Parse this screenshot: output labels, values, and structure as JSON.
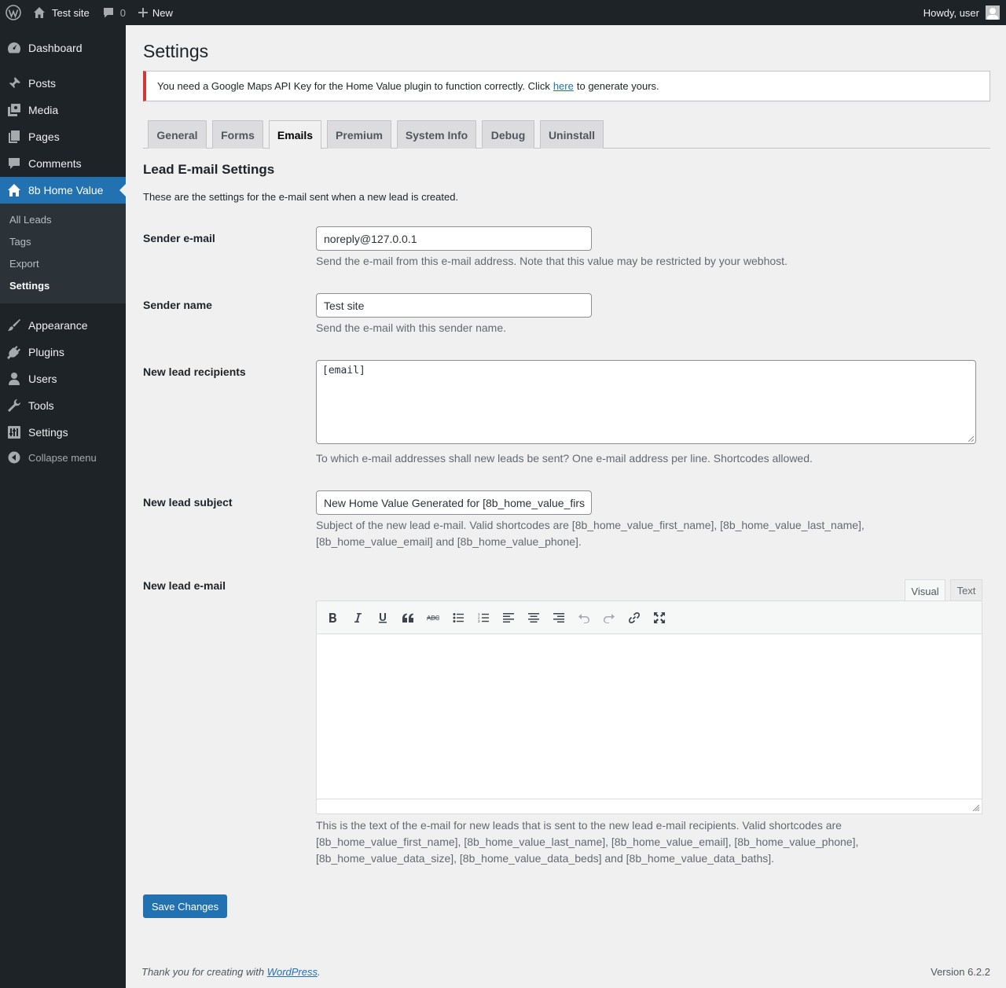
{
  "adminbar": {
    "site_name": "Test site",
    "comments_count": "0",
    "new_label": "New",
    "howdy": "Howdy, user"
  },
  "menu": {
    "items": [
      {
        "label": "Dashboard",
        "icon": "dashboard-icon"
      },
      {
        "label": "Posts",
        "icon": "pin-icon"
      },
      {
        "label": "Media",
        "icon": "media-icon"
      },
      {
        "label": "Pages",
        "icon": "pages-icon"
      },
      {
        "label": "Comments",
        "icon": "comment-icon"
      },
      {
        "label": "8b Home Value",
        "icon": "home-icon"
      },
      {
        "label": "Appearance",
        "icon": "brush-icon"
      },
      {
        "label": "Plugins",
        "icon": "plug-icon"
      },
      {
        "label": "Users",
        "icon": "user-icon"
      },
      {
        "label": "Tools",
        "icon": "wrench-icon"
      },
      {
        "label": "Settings",
        "icon": "settings-icon"
      }
    ],
    "submenu": [
      "All Leads",
      "Tags",
      "Export",
      "Settings"
    ],
    "collapse_label": "Collapse menu"
  },
  "page": {
    "title": "Settings",
    "notice": {
      "text_before": "You need a Google Maps API Key for the Home Value plugin to function correctly. Click",
      "link": "here",
      "text_after": "to generate yours."
    },
    "tabs": [
      "General",
      "Forms",
      "Emails",
      "Premium",
      "System Info",
      "Debug",
      "Uninstall"
    ],
    "active_tab": "Emails",
    "section_title": "Lead E-mail Settings",
    "section_desc": "These are the settings for the e-mail sent when a new lead is created."
  },
  "fields": {
    "sender_email": {
      "label": "Sender e-mail",
      "value": "noreply@127.0.0.1",
      "desc": "Send the e-mail from this e-mail address. Note that this value may be restricted by your webhost."
    },
    "sender_name": {
      "label": "Sender name",
      "value": "Test site",
      "desc": "Send the e-mail with this sender name."
    },
    "recipients": {
      "label": "New lead recipients",
      "value": "[email]",
      "desc": "To which e-mail addresses shall new leads be sent? One e-mail address per line. Shortcodes allowed."
    },
    "subject": {
      "label": "New lead subject",
      "value": "New Home Value Generated for [8b_home_value_firs",
      "desc": "Subject of the new lead e-mail. Valid shortcodes are [8b_home_value_first_name], [8b_home_value_last_name], [8b_home_value_email] and [8b_home_value_phone]."
    },
    "email": {
      "label": "New lead e-mail",
      "editor_tabs": [
        "Visual",
        "Text"
      ],
      "desc": "This is the text of the e-mail for new leads that is sent to the new lead e-mail recipients. Valid shortcodes are [8b_home_value_first_name], [8b_home_value_last_name], [8b_home_value_email], [8b_home_value_phone], [8b_home_value_data_size], [8b_home_value_data_beds] and [8b_home_value_data_baths]."
    }
  },
  "save_label": "Save Changes",
  "footer": {
    "thanks": "Thank you for creating with",
    "link": "WordPress",
    "version": "Version 6.2.2"
  }
}
